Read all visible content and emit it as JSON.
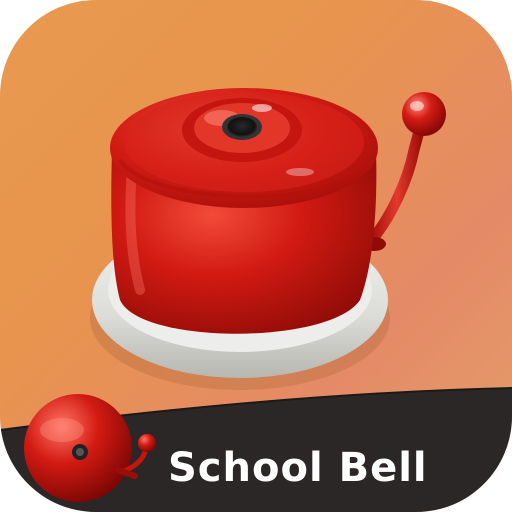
{
  "app": {
    "title": "School Bell"
  },
  "icons": {
    "main": "bell-button-icon",
    "small": "ringing-bell-icon"
  },
  "colors": {
    "background_start": "#e89a4f",
    "background_end": "#e3a06a",
    "bell_red": "#d11a12",
    "bell_dark": "#8f0b07",
    "base_white": "#e9e9e6",
    "banner_dark": "#2b2726",
    "text": "#ffffff"
  }
}
